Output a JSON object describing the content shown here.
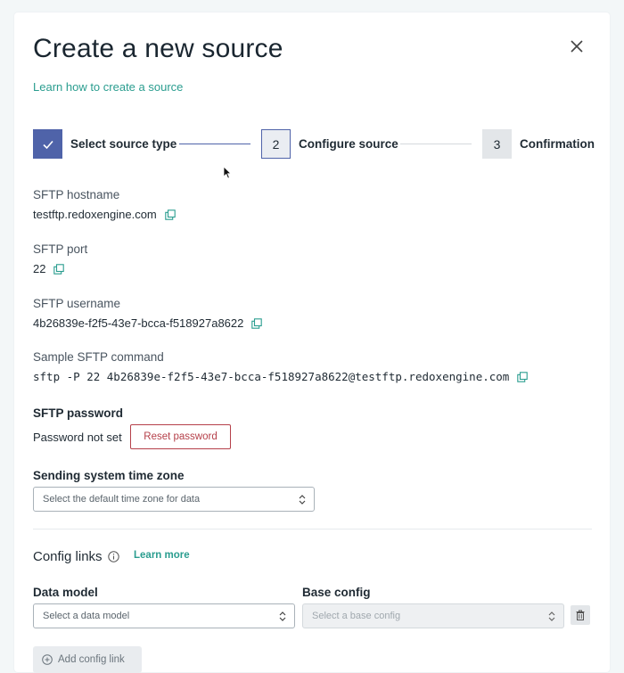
{
  "modal": {
    "title": "Create a new source",
    "learn_link": "Learn how to create a source"
  },
  "stepper": {
    "steps": [
      {
        "number": "✓",
        "label": "Select source type",
        "state": "complete"
      },
      {
        "number": "2",
        "label": "Configure source",
        "state": "active"
      },
      {
        "number": "3",
        "label": "Confirmation",
        "state": "upcoming"
      }
    ]
  },
  "fields": {
    "hostname": {
      "label": "SFTP hostname",
      "value": "testftp.redoxengine.com"
    },
    "port": {
      "label": "SFTP port",
      "value": "22"
    },
    "username": {
      "label": "SFTP username",
      "value": "4b26839e-f2f5-43e7-bcca-f518927a8622"
    },
    "command": {
      "label": "Sample SFTP command",
      "value": "sftp -P 22 4b26839e-f2f5-43e7-bcca-f518927a8622@testftp.redoxengine.com"
    },
    "password": {
      "label": "SFTP password",
      "status": "Password not set",
      "reset_label": "Reset password"
    },
    "timezone": {
      "label": "Sending system time zone",
      "placeholder": "Select the default time zone for data"
    }
  },
  "config_links": {
    "title": "Config links",
    "learn_more": "Learn more",
    "data_model": {
      "label": "Data model",
      "placeholder": "Select a data model"
    },
    "base_config": {
      "label": "Base config",
      "placeholder": "Select a base config"
    },
    "add_label": "Add config link"
  },
  "colors": {
    "accent": "#2a9d8f",
    "step_primary": "#4f63a9",
    "danger": "#b5404a"
  }
}
